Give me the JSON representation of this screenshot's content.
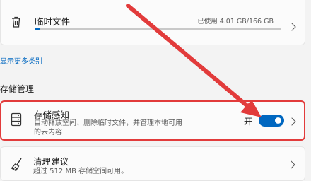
{
  "temp_files": {
    "icon": "trash-icon",
    "title": "临时文件",
    "usage": "已使用 4.01 GB/166 GB",
    "used_fraction": 0.024
  },
  "more_link": "显示更多类别",
  "section_heading": "存储管理",
  "storage_sense": {
    "icon": "storage-sense-icon",
    "title": "存储感知",
    "desc_line1": "自动释放空间、删除临时文件，并管理本地可用",
    "desc_line2": "的云内容",
    "state": "开",
    "toggle_on": true
  },
  "cleanup": {
    "icon": "broom-icon",
    "title": "清理建议",
    "desc": "超过 512 MB 存储空间可用。"
  },
  "colors": {
    "accent": "#0067c0",
    "annotation": "#e23b3b"
  }
}
